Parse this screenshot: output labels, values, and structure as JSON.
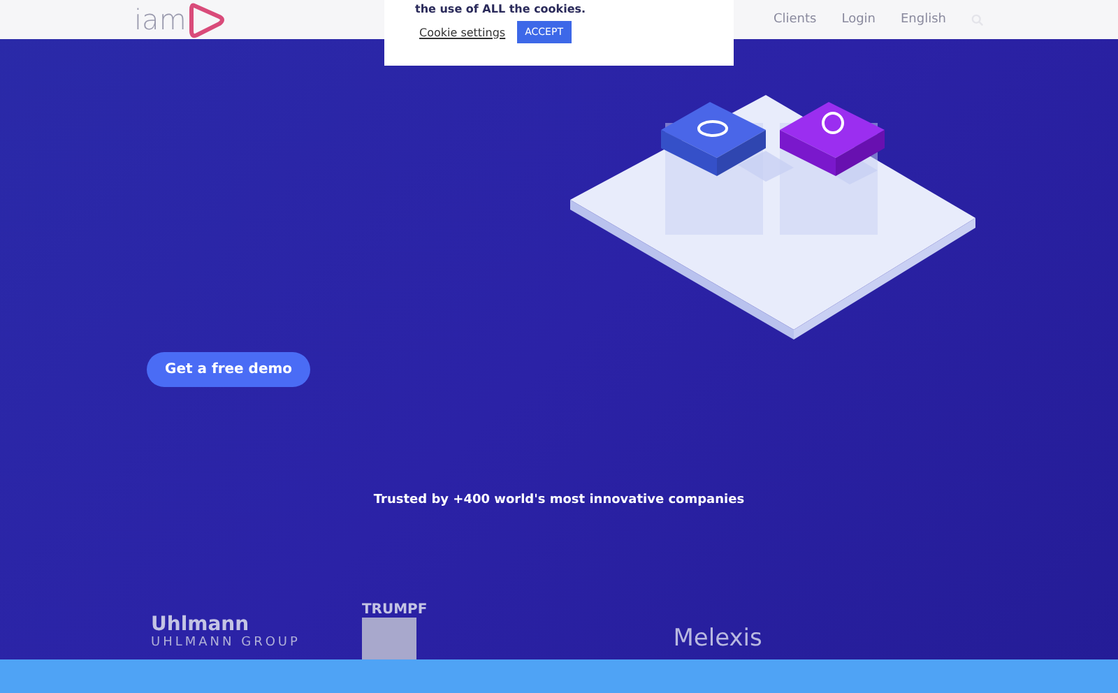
{
  "header": {
    "logo": "iam",
    "nav": [
      "Clients",
      "Login",
      "English"
    ]
  },
  "cookie_banner": {
    "text": "the use of ALL the cookies.",
    "settings_link": "Cookie settings",
    "accept_button": "ACCEPT"
  },
  "hero": {
    "cta_button": "Get a free demo",
    "trusted_text": "Trusted by +400 world's most innovative companies"
  },
  "client_logos": [
    {
      "kind": "uhlmann",
      "name": "Uhlmann",
      "subtitle": "UHLMANN GROUP"
    },
    {
      "kind": "trumpf",
      "name": "TRUMPF"
    },
    {
      "kind": "melexis",
      "name": "Melexis"
    }
  ]
}
